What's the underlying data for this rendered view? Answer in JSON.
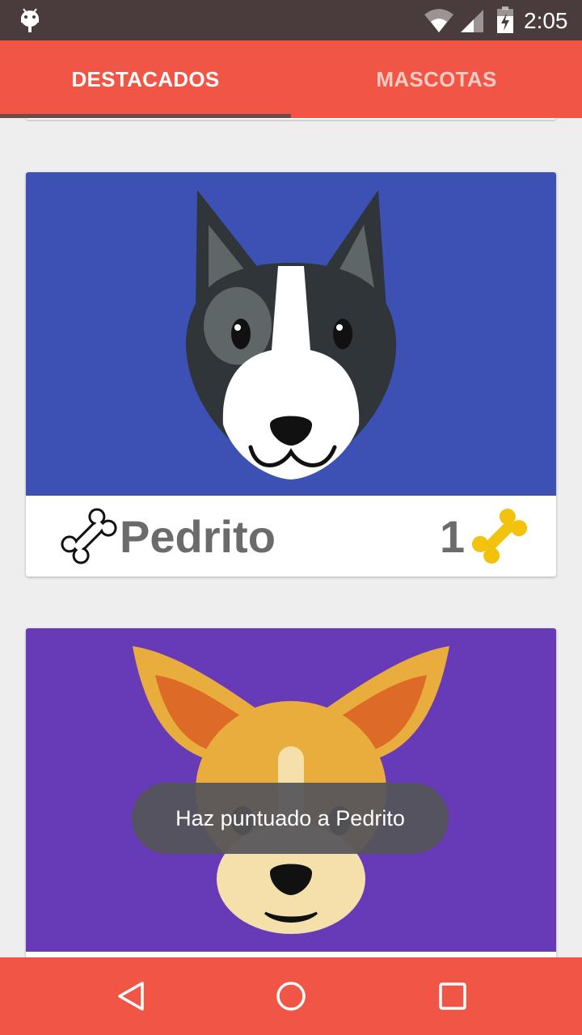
{
  "status_bar": {
    "time": "2:05",
    "icons": [
      "android-icon",
      "wifi-icon",
      "signal-icon",
      "battery-charging-icon"
    ]
  },
  "tabs": [
    {
      "label": "DESTACADOS",
      "active": true
    },
    {
      "label": "MASCOTAS",
      "active": false
    }
  ],
  "pets": [
    {
      "name": "Pedrito",
      "rating": "1",
      "image": "boston-terrier-face",
      "background": "#3d50b4"
    },
    {
      "name": "",
      "rating": "",
      "image": "chihuahua-face",
      "background": "#673ab7"
    }
  ],
  "toast": {
    "message": "Haz puntuado a Pedrito"
  },
  "nav_bar": {
    "buttons": [
      "back-icon",
      "home-icon",
      "recents-icon"
    ]
  },
  "colors": {
    "primary": "#f05545",
    "status_bar": "#4a3b3c",
    "bone_gold": "#f2c20c",
    "text_gray": "#6b6b6b"
  }
}
